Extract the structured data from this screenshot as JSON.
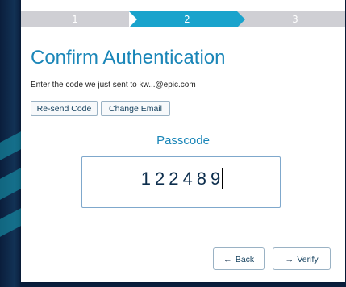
{
  "stepper": {
    "steps": [
      "1",
      "2",
      "3"
    ],
    "active_step": "2"
  },
  "title": "Confirm Authentication",
  "subtitle": "Enter the code we just sent to kw...@epic.com",
  "actions": {
    "resend_label": "Re-send Code",
    "change_email_label": "Change Email"
  },
  "passcode": {
    "label": "Passcode",
    "value": "122489"
  },
  "nav": {
    "back_label": "Back",
    "verify_label": "Verify",
    "back_icon": "arrow-left-icon",
    "verify_icon": "arrow-right-icon"
  },
  "colors": {
    "accent": "#1aa3cc",
    "title": "#1a86b8",
    "step_inactive": "#cfcfd4"
  }
}
